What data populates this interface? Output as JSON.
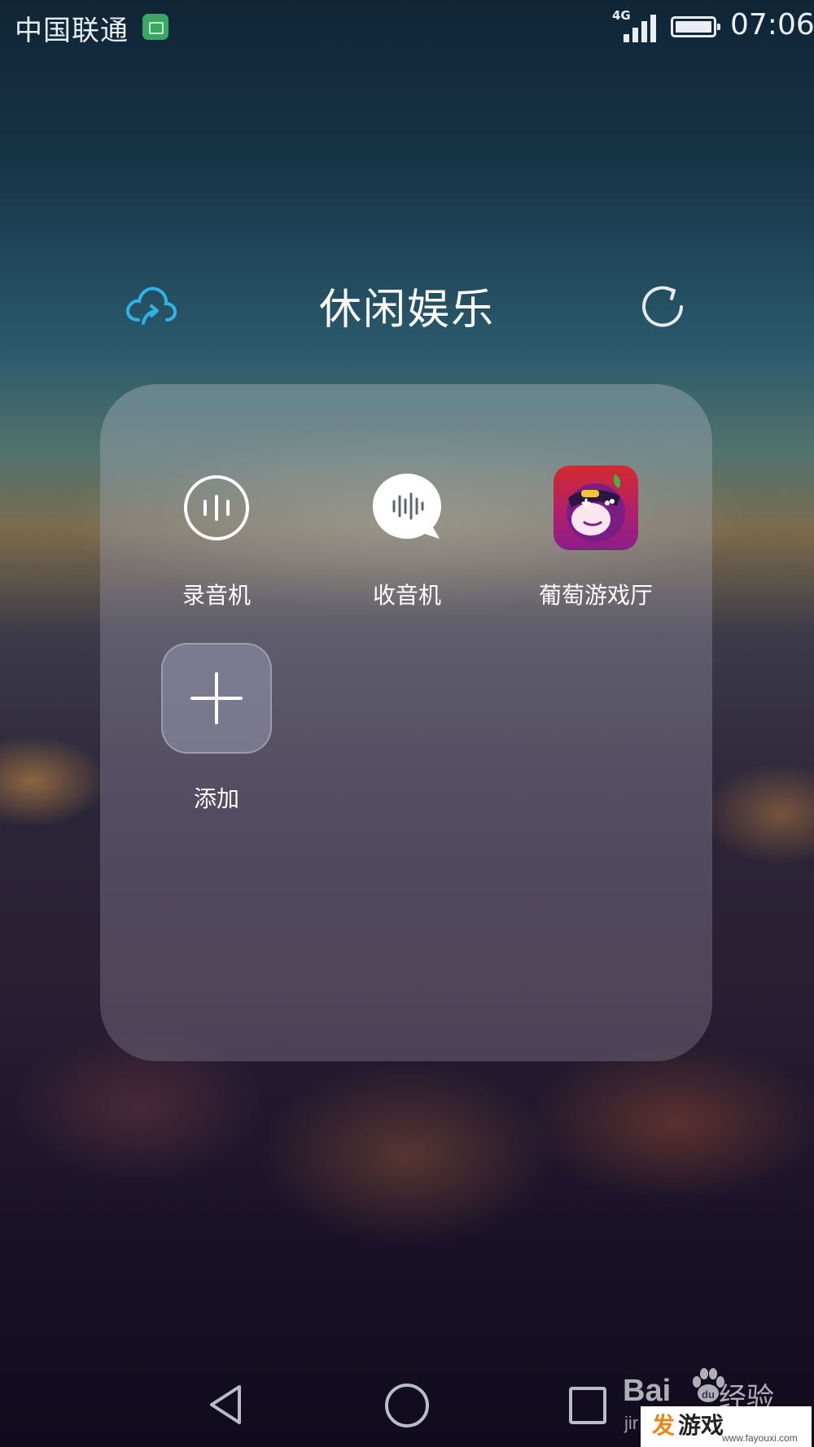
{
  "status_bar": {
    "carrier": "中国联通",
    "network_type": "4G",
    "time": "07:06",
    "battery_level": 1.0
  },
  "folder": {
    "title": "休闲娱乐",
    "left_icon": "cloud-upload-icon",
    "right_icon": "refresh-icon",
    "apps": [
      {
        "label": "录音机",
        "icon": "sound-recorder-icon"
      },
      {
        "label": "收音机",
        "icon": "fm-radio-icon"
      },
      {
        "label": "葡萄游戏厅",
        "icon": "putao-game-hall-icon"
      },
      {
        "label": "添加",
        "icon": "plus-icon"
      }
    ]
  },
  "nav_bar": {
    "back_icon": "back-triangle-icon",
    "home_icon": "home-circle-icon",
    "recent_icon": "recent-square-icon"
  },
  "watermark": {
    "baidu": "Bai",
    "jingyan": "经验",
    "jin": "jir",
    "fa": "发",
    "youxi": "游戏",
    "url": "www.fayouxi.com"
  },
  "colors": {
    "accent_cloud": "#2fb3e6",
    "sim_badge": "#3aa765",
    "game_icon_red": "#d0252f",
    "game_icon_purple": "#8a1e8c",
    "watermark_orange": "#e8861a"
  }
}
